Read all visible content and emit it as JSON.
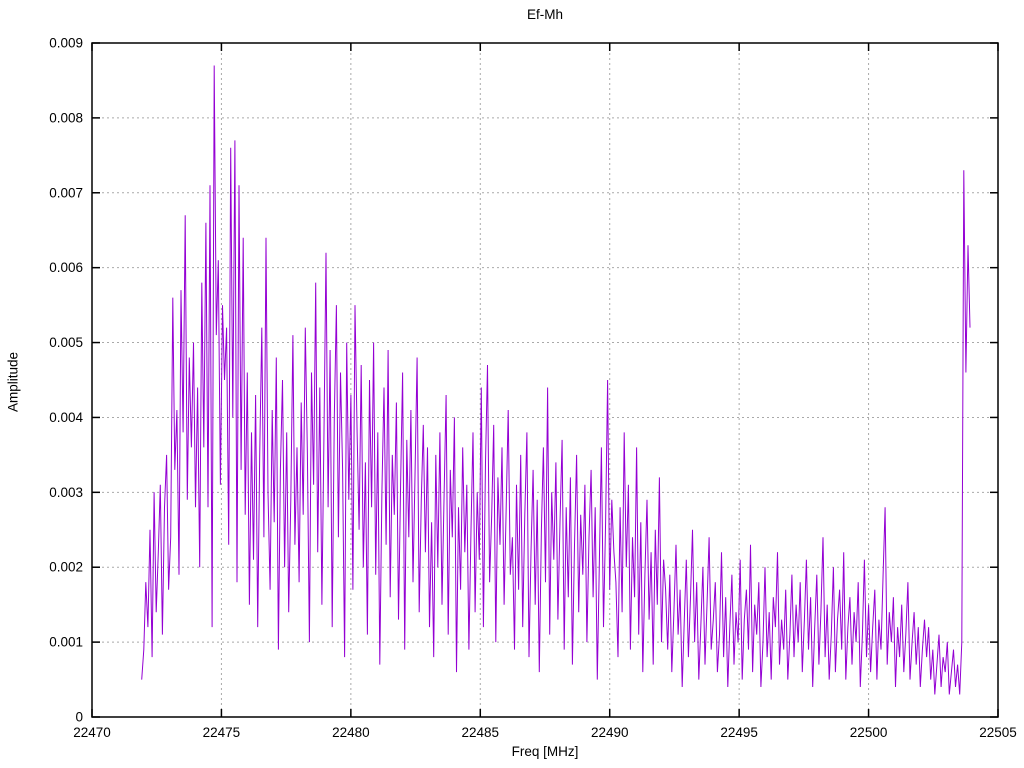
{
  "chart_data": {
    "type": "line",
    "title": "Ef-Mh",
    "xlabel": "Freq [MHz]",
    "ylabel": "Amplitude",
    "xlim": [
      22470,
      22505
    ],
    "ylim": [
      0,
      0.009
    ],
    "xticks": [
      22470,
      22475,
      22480,
      22485,
      22490,
      22495,
      22500,
      22505
    ],
    "xtick_labels": [
      "22470",
      "22475",
      "22480",
      "22485",
      "22490",
      "22495",
      "22500",
      "22505"
    ],
    "yticks": [
      0,
      0.001,
      0.002,
      0.003,
      0.004,
      0.005,
      0.006,
      0.007,
      0.008,
      0.009
    ],
    "ytick_labels": [
      "0",
      "0.001",
      "0.002",
      "0.003",
      "0.004",
      "0.005",
      "0.006",
      "0.007",
      "0.008",
      "0.009"
    ],
    "grid": true,
    "legend_position": "none",
    "line_color": "#9400d3",
    "grid_color": "#a9a9a9",
    "border_color": "#000000",
    "series": [
      {
        "name": "Ef-Mh",
        "freq_start": 22471.92,
        "freq_step": 0.08,
        "amp_scale": 0.0001,
        "amps": [
          5,
          9,
          18,
          12,
          25,
          8,
          30,
          14,
          22,
          31,
          11,
          28,
          35,
          17,
          24,
          56,
          33,
          41,
          19,
          57,
          38,
          67,
          29,
          48,
          36,
          50,
          28,
          44,
          20,
          58,
          36,
          66,
          28,
          71,
          12,
          87,
          51,
          61,
          31,
          55,
          45,
          52,
          23,
          76,
          40,
          77,
          18,
          71,
          33,
          64,
          27,
          46,
          15,
          38,
          21,
          43,
          12,
          35,
          52,
          24,
          64,
          30,
          17,
          41,
          26,
          48,
          9,
          33,
          45,
          20,
          38,
          14,
          29,
          51,
          23,
          36,
          18,
          42,
          27,
          52,
          35,
          10,
          46,
          31,
          58,
          22,
          44,
          15,
          37,
          62,
          28,
          49,
          12,
          40,
          55,
          24,
          46,
          33,
          8,
          50,
          29,
          43,
          17,
          55,
          38,
          25,
          47,
          20,
          34,
          11,
          45,
          28,
          50,
          19,
          38,
          7,
          30,
          44,
          23,
          49,
          16,
          35,
          27,
          42,
          13,
          31,
          46,
          9,
          37,
          24,
          41,
          18,
          33,
          48,
          14,
          29,
          39,
          22,
          36,
          12,
          26,
          8,
          35,
          20,
          38,
          15,
          29,
          43,
          11,
          33,
          24,
          40,
          6,
          28,
          17,
          36,
          22,
          31,
          9,
          25,
          38,
          14,
          30,
          21,
          44,
          12,
          34,
          47,
          18,
          27,
          39,
          10,
          32,
          23,
          36,
          15,
          28,
          41,
          19,
          24,
          9,
          31,
          17,
          35,
          12,
          27,
          38,
          8,
          22,
          33,
          15,
          29,
          6,
          25,
          36,
          18,
          44,
          11,
          30,
          21,
          34,
          13,
          26,
          37,
          9,
          28,
          16,
          32,
          7,
          23,
          35,
          14,
          27,
          19,
          31,
          10,
          24,
          33,
          16,
          28,
          5,
          21,
          36,
          12,
          26,
          45,
          17,
          29,
          22,
          18,
          8,
          28,
          14,
          38,
          20,
          31,
          9,
          24,
          16,
          36,
          11,
          26,
          6,
          19,
          29,
          13,
          22,
          7,
          25,
          15,
          32,
          10,
          21,
          17,
          9,
          19,
          6,
          14,
          23,
          11,
          17,
          4,
          13,
          21,
          8,
          16,
          25,
          10,
          18,
          5,
          12,
          20,
          7,
          15,
          24,
          9,
          13,
          18,
          6,
          11,
          22,
          8,
          16,
          4,
          12,
          19,
          7,
          14,
          10,
          21,
          5,
          13,
          17,
          9,
          23,
          6,
          15,
          11,
          18,
          4,
          10,
          20,
          8,
          14,
          5,
          16,
          12,
          22,
          7,
          13,
          9,
          17,
          5,
          11,
          19,
          8,
          15,
          10,
          18,
          6,
          13,
          21,
          9,
          16,
          4,
          12,
          19,
          7,
          14,
          24,
          8,
          15,
          5,
          11,
          20,
          6,
          13,
          17,
          9,
          22,
          5,
          12,
          16,
          7,
          14,
          10,
          18,
          4,
          11,
          21,
          8,
          15,
          6,
          12,
          17,
          5,
          13,
          9,
          19,
          28,
          7,
          14,
          10,
          16,
          4,
          12,
          8,
          15,
          6,
          11,
          18,
          5,
          10,
          14,
          7,
          12,
          4,
          9,
          13,
          8,
          12,
          5,
          9,
          3,
          7,
          11,
          4,
          8,
          6,
          10,
          3,
          6,
          9,
          4,
          7,
          3,
          10,
          73,
          46,
          63,
          52
        ]
      }
    ]
  }
}
